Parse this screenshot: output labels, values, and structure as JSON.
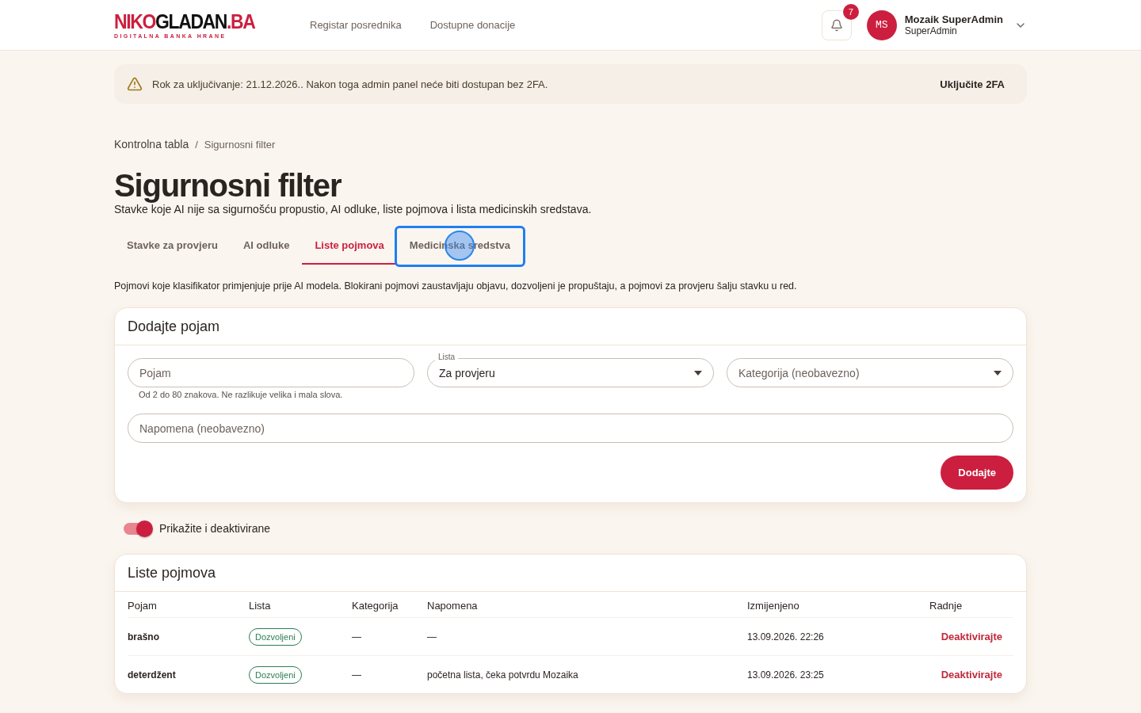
{
  "header": {
    "logo": {
      "part_1": "NIKO",
      "part_2": "GLADAN",
      "part_3": ".BA",
      "tagline": "DIGITALNA BANKA HRANE"
    },
    "nav": [
      {
        "label": "Registar posrednika"
      },
      {
        "label": "Dostupne donacije"
      }
    ],
    "notifications": {
      "count": "7"
    },
    "user": {
      "initials": "MS",
      "name": "Mozaik SuperAdmin",
      "role": "SuperAdmin"
    }
  },
  "banner": {
    "text": "Rok za uključivanje: 21.12.2026.. Nakon toga admin panel neće biti dostupan bez 2FA.",
    "action": "Uključite 2FA"
  },
  "breadcrumb": [
    {
      "label": "Kontrolna tabla"
    },
    {
      "label": "Sigurnosni filter"
    }
  ],
  "breadcrumb_separator": "/",
  "title": "Sigurnosni filter",
  "subtitle": "Stavke koje AI nije sa sigurnošću propustio, AI odluke, liste pojmova i lista medicinskih sredstava.",
  "tabs": [
    {
      "label": "Stavke za provjeru",
      "selected": false,
      "focused": false
    },
    {
      "label": "AI odluke",
      "selected": false,
      "focused": false
    },
    {
      "label": "Liste pojmova",
      "selected": true,
      "focused": false
    },
    {
      "label": "Medicinska sredstva",
      "selected": false,
      "focused": true
    }
  ],
  "description": "Pojmovi koje klasifikator primjenjuje prije AI modela. Blokirani pojmovi zaustavljaju objavu, dozvoljeni je propuštaju, a pojmovi za provjeru šalju stavku u red.",
  "add_form": {
    "title": "Dodajte pojam",
    "fields": [
      {
        "kind": "input",
        "placeholder": "Pojam",
        "helper": "Od 2 do 80 znakova. Ne razlikuje velika i mala slova."
      },
      {
        "kind": "select",
        "label": "Lista",
        "value": "Za provjeru"
      },
      {
        "kind": "select",
        "placeholder": "Kategorija (neobavezno)"
      }
    ],
    "note": {
      "placeholder": "Napomena (neobavezno)"
    },
    "submit": "Dodajte"
  },
  "toggle": {
    "label": "Prikažite i deaktivirane",
    "on": true
  },
  "table": {
    "title": "Liste pojmova",
    "columns": [
      "Pojam",
      "Lista",
      "Kategorija",
      "Napomena",
      "Izmijenjeno",
      "Radnje"
    ],
    "rows": [
      {
        "term": "brašno",
        "list": "Dozvoljeni",
        "color": "#2e7d52",
        "category": "—",
        "note": "—",
        "modified": "13.09.2026. 22:26",
        "action": "Deaktivirajte"
      },
      {
        "term": "deterdžent",
        "list": "Dozvoljeni",
        "color": "#2e7d52",
        "category": "—",
        "note": "početna lista, čeka potvrdu Mozaika",
        "modified": "13.09.2026. 23:25",
        "action": "Deaktivirajte"
      }
    ]
  }
}
